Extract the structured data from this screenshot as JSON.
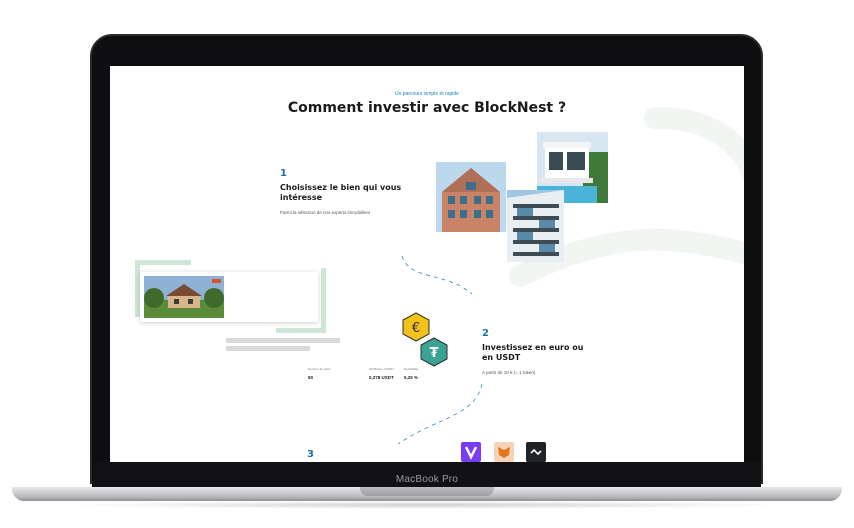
{
  "device": {
    "label": "MacBook Pro"
  },
  "section": {
    "kicker": "Un parcours simple et rapide",
    "title": "Comment investir avec BlockNest ?"
  },
  "steps": [
    {
      "number": "1",
      "title": "Choisissez le bien qui vous intéresse",
      "description": "Parmi la sélection de nos experts immobiliers"
    },
    {
      "number": "2",
      "title": "Investissez en euro ou en USDT",
      "description": "A partir de 10 € (= 1 token)"
    },
    {
      "number": "3"
    }
  ],
  "property_card": {
    "meta": [
      {
        "label": "Nombre de parts",
        "value": "50"
      },
      {
        "label": "Tarif/token (USDT)",
        "value": "0,378 USDT"
      },
      {
        "label": "Rentabilité",
        "value": "5,25 %"
      }
    ]
  },
  "icons": {
    "euro": "euro-coin-icon",
    "usdt": "tether-coin-icon",
    "wallets": [
      "vechain-wallet-icon",
      "metamask-wallet-icon",
      "wallet-connect-icon"
    ]
  },
  "colors": {
    "accent_blue": "#1b82c4",
    "step_blue": "#1b6fa6",
    "euro_yellow": "#f2c21b",
    "tether_green": "#3aa393",
    "frame_green": "#cfe6d6",
    "vechain_purple": "#7a3cf0",
    "metamask_orange": "#f6d2b8",
    "dark_tile": "#1f2326"
  }
}
